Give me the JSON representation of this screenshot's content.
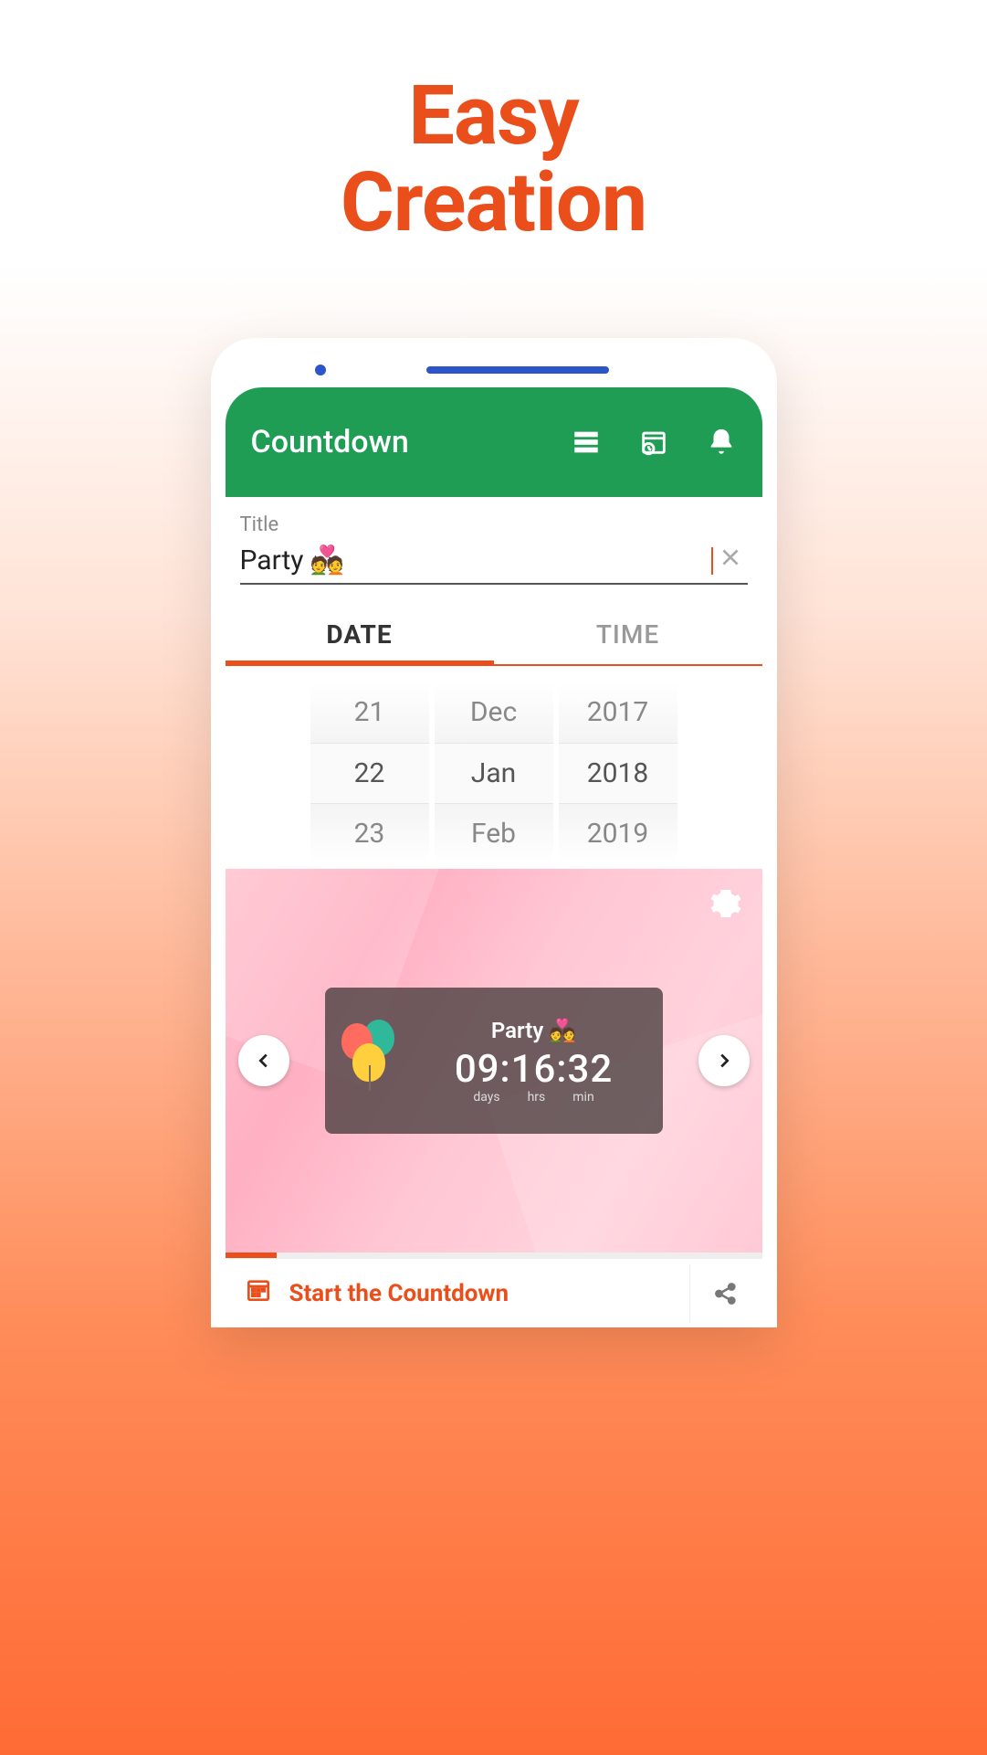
{
  "promo": {
    "line1": "Easy",
    "line2": "Creation"
  },
  "app_bar": {
    "title": "Countdown"
  },
  "title_field": {
    "label": "Title",
    "value": "Party 💑"
  },
  "tabs": {
    "date": "DATE",
    "time": "TIME"
  },
  "picker": {
    "day": {
      "prev": "21",
      "sel": "22",
      "next": "23"
    },
    "month": {
      "prev": "Dec",
      "sel": "Jan",
      "next": "Feb"
    },
    "year": {
      "prev": "2017",
      "sel": "2018",
      "next": "2019"
    }
  },
  "preview": {
    "title": "Party 💑",
    "digits": "09:16:32",
    "labels": {
      "days": "days",
      "hrs": "hrs",
      "min": "min"
    }
  },
  "bottom": {
    "start": "Start the Countdown"
  }
}
